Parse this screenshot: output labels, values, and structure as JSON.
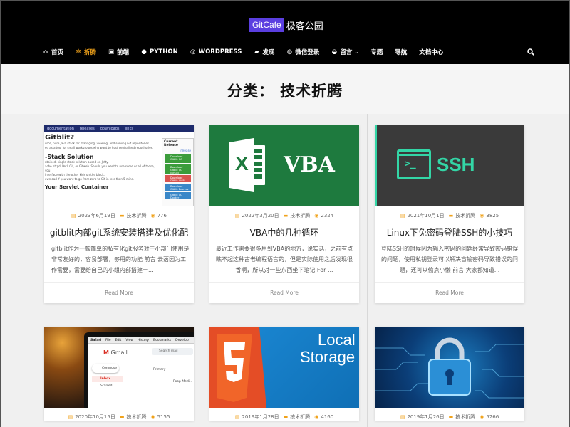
{
  "header": {
    "logo_badge": "GitCafe",
    "logo_text": "极客公园",
    "nav": [
      {
        "label": "首页",
        "icon": "home-icon"
      },
      {
        "label": "折腾",
        "icon": "gears-icon",
        "active": true
      },
      {
        "label": "前端",
        "icon": "html5-icon"
      },
      {
        "label": "PYTHON",
        "icon": "python-icon"
      },
      {
        "label": "WORDPRESS",
        "icon": "wordpress-icon"
      },
      {
        "label": "发现",
        "icon": "briefcase-icon"
      },
      {
        "label": "微信登录",
        "icon": "wechat-icon"
      },
      {
        "label": "留言",
        "icon": "comments-icon",
        "has_caret": true
      },
      {
        "label": "专题"
      },
      {
        "label": "导航"
      },
      {
        "label": "文档中心"
      }
    ]
  },
  "hero": {
    "title": "分类：  技术折腾"
  },
  "colors": {
    "accent": "#f0a21a",
    "header_bg": "#000000",
    "logo_badge": "#5b3fe0"
  },
  "cards": [
    {
      "date": "2023年6月19日",
      "category": "技术折腾",
      "views": "776",
      "title": "gitblit内部git系统安装搭建及优化配",
      "excerpt": "gitblit作为一款简单的私有化git服务对于小部门使用是非常友好的，容易部署，够用的功能 前言 云落因为工作需要，需要给自己的小组内部搭建一...",
      "read_more": "Read More",
      "thumb": {
        "nav": [
          "documentation",
          "releases",
          "downloads",
          "links"
        ],
        "heading": "Gitblit?",
        "lines": [
          "urce, pure Java stack for managing, viewing, and serving Git repositories.",
          "ed as a tool for small workgroups who want to host centralized repositories."
        ],
        "heading2": "-Stack Solution",
        "lines2": [
          "ntained, single-stack solution based on Jetty.",
          "ache httpd, Perl, Git, or Gitweb. Should you want to use some or all of those, you",
          "interface with the other kids on the block.",
          "ownload if you want to go from zero to Git in less than 5 mins."
        ],
        "heading3": "Your Servlet Container",
        "side_title": "Current Release",
        "side_sub": "release",
        "side_buttons": [
          "Download Gitblit GO",
          "Download Gitblit GO (Linux)",
          "Download Gitblit WAR",
          "Download Gitblit Express",
          "Gitblit GO Docker"
        ]
      }
    },
    {
      "date": "2022年3月20日",
      "category": "技术折腾",
      "views": "2324",
      "title": "VBA中的几种循环",
      "excerpt": "最近工作需要很多用到VBA的地方，说实话，之前有点瞧不起这种古老编程语言的，但是实际使用之后发现很香啊，所以对一些东西坐下笔记 For ...",
      "read_more": "Read More",
      "thumb": {
        "letter": "X",
        "text": "VBA"
      }
    },
    {
      "date": "2021年10月1日",
      "category": "技术折腾",
      "views": "3825",
      "title": "Linux下免密码登陆SSH的小技巧",
      "excerpt": "登陆SSH的时候因为输入密码的问题经常导致密码错误的问题，使用私钥登录可以解决盲输密码导致错误的问题，还可以偷点小懒 前言 大家都知道...",
      "read_more": "Read More",
      "thumb": {
        "prompt": ">_",
        "text": "SSH"
      }
    },
    {
      "date": "2020年10月15日",
      "category": "技术折腾",
      "views": "5155",
      "title": "",
      "excerpt": "",
      "read_more": "",
      "thumb": {
        "menu": [
          "Safari",
          "File",
          "Edit",
          "View",
          "History",
          "Bookmarks",
          "Develop"
        ],
        "app": "Gmail",
        "search": "Search mail",
        "compose": "Compose",
        "inbox": "Inbox",
        "starred": "Starred",
        "primary": "Primary",
        "row": "Poop Medi..."
      }
    },
    {
      "date": "2019年1月28日",
      "category": "技术折腾",
      "views": "4160",
      "title": "",
      "excerpt": "",
      "read_more": "",
      "thumb": {
        "line1": "Local",
        "line2": "Storage"
      }
    },
    {
      "date": "2019年1月26日",
      "category": "技术折腾",
      "views": "5266",
      "title": "",
      "excerpt": "",
      "read_more": "",
      "thumb": {}
    }
  ]
}
